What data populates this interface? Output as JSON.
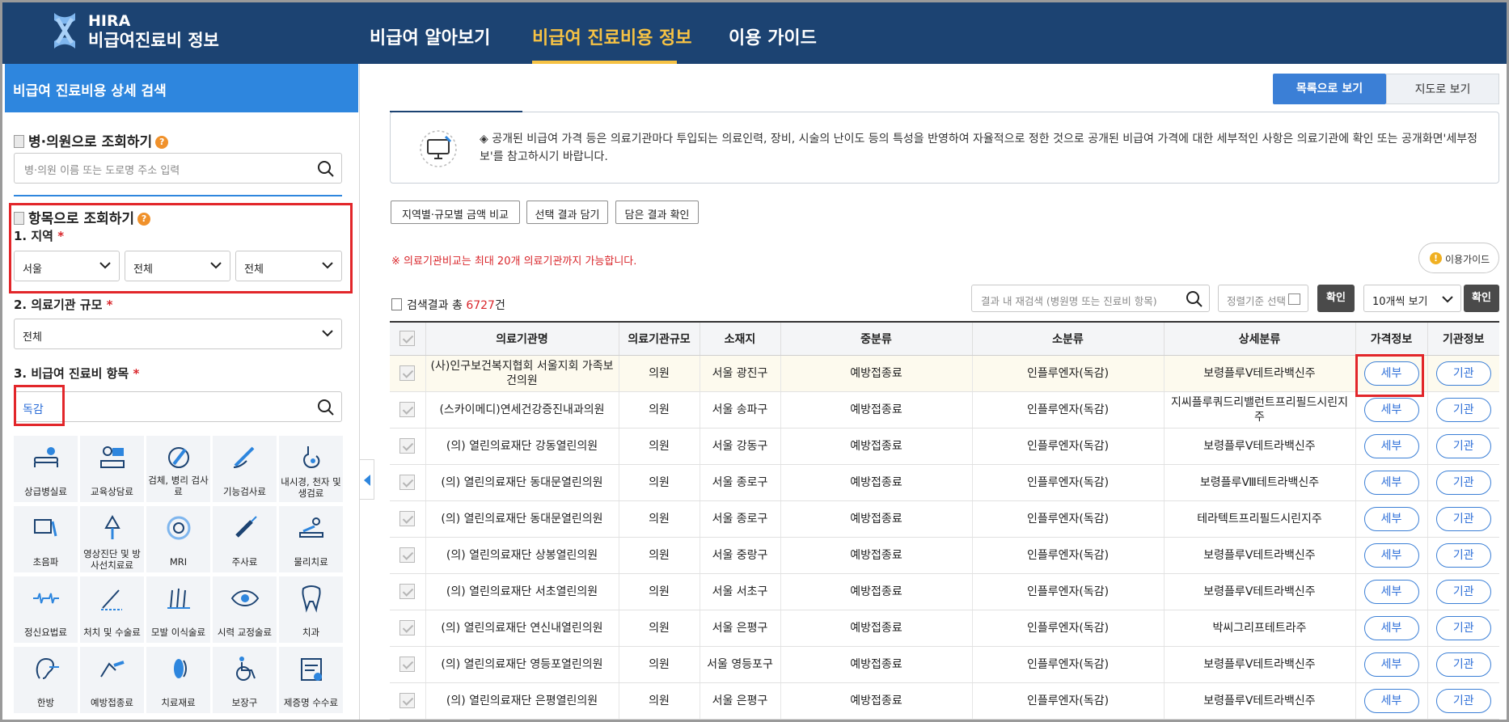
{
  "header": {
    "brand_line1": "HIRA",
    "brand_line2": "비급여진료비 정보",
    "nav": [
      "비급여 알아보기",
      "비급여 진료비용 정보",
      "이용 가이드"
    ],
    "active_nav": 1
  },
  "sidebar": {
    "title": "비급여 진료비용 상세 검색",
    "hospital_search": {
      "heading": "병·의원으로 조회하기",
      "placeholder": "병·의원 이름 또는 도로명 주소 입력"
    },
    "item_search": {
      "heading": "항목으로 조회하기",
      "region_label": "1. 지역",
      "region_values": [
        "서울",
        "전체",
        "전체"
      ],
      "scale_label": "2. 의료기관 규모",
      "scale_value": "전체",
      "item_label": "3. 비급여 진료비 항목",
      "item_value": "독감",
      "required_mark": "*"
    },
    "categories": [
      [
        "상급병실료",
        "교육상담료",
        "검체, 병리 검사료",
        "기능검사료",
        "내시경, 천자 및 생검료"
      ],
      [
        "초음파",
        "영상진단 및 방사선치료료",
        "MRI",
        "주사료",
        "물리치료"
      ],
      [
        "정신요법료",
        "처치 및 수술료",
        "모발 이식술료",
        "시력 교정술료",
        "치과"
      ],
      [
        "한방",
        "예방접종료",
        "치료재료",
        "보장구",
        "제증명 수수료"
      ]
    ]
  },
  "main": {
    "view_list": "목록으로 보기",
    "view_map": "지도로 보기",
    "notice": "◈ 공개된 비급여 가격 등은 의료기관마다 투입되는 의료인력, 장비, 시술의 난이도 등의 특성을 반영하여 자율적으로 정한 것으로 공개된 비급여 가격에 대한 세부적인 사항은 의료기관에 확인 또는 공개화면'세부정보'를 참고하시기 바랍니다.",
    "action_buttons": [
      "지역별·규모별 금액 비교",
      "선택 결과 담기",
      "담은 결과 확인"
    ],
    "warning": "※ 의료기관비교는 최대 20개 의료기관까지 가능합니다.",
    "guide": "이용가이드",
    "result_prefix": "검색결과 총",
    "result_count": "6727",
    "result_suffix": "건",
    "inner_search_placeholder": "결과 내 재검색 (병원명 또는 진료비 항목)",
    "sort_placeholder": "정렬기준 선택",
    "confirm": "확인",
    "per_page": "10개씩 보기"
  },
  "table": {
    "columns": [
      "의료기관명",
      "의료기관규모",
      "소재지",
      "중분류",
      "소분류",
      "상세분류",
      "가격정보",
      "기관정보"
    ],
    "detail_label": "세부",
    "org_label": "기관",
    "rows": [
      [
        "(사)인구보건복지협회 서울지회 가족보건의원",
        "의원",
        "서울 광진구",
        "예방접종료",
        "인플루엔자(독감)",
        "보령플루Ⅴ테트라백신주"
      ],
      [
        "(스카이메디)연세건강증진내과의원",
        "의원",
        "서울 송파구",
        "예방접종료",
        "인플루엔자(독감)",
        "지씨플루쿼드리밸런트프리필드시린지주"
      ],
      [
        "(의) 열린의료재단 강동열린의원",
        "의원",
        "서울 강동구",
        "예방접종료",
        "인플루엔자(독감)",
        "보령플루Ⅴ테트라백신주"
      ],
      [
        "(의) 열린의료재단 동대문열린의원",
        "의원",
        "서울 종로구",
        "예방접종료",
        "인플루엔자(독감)",
        "보령플루Ⅷ테트라백신주"
      ],
      [
        "(의) 열린의료재단 동대문열린의원",
        "의원",
        "서울 종로구",
        "예방접종료",
        "인플루엔자(독감)",
        "테라텍트프리필드시린지주"
      ],
      [
        "(의) 열린의료재단 상봉열린의원",
        "의원",
        "서울 중랑구",
        "예방접종료",
        "인플루엔자(독감)",
        "보령플루Ⅴ테트라백신주"
      ],
      [
        "(의) 열린의료재단 서초열린의원",
        "의원",
        "서울 서초구",
        "예방접종료",
        "인플루엔자(독감)",
        "보령플루Ⅴ테트라백신주"
      ],
      [
        "(의) 열린의료재단 연신내열린의원",
        "의원",
        "서울 은평구",
        "예방접종료",
        "인플루엔자(독감)",
        "박씨그리프테트라주"
      ],
      [
        "(의) 열린의료재단 영등포열린의원",
        "의원",
        "서울 영등포구",
        "예방접종료",
        "인플루엔자(독감)",
        "보령플루Ⅴ테트라백신주"
      ],
      [
        "(의) 열린의료재단 은평열린의원",
        "의원",
        "서울 은평구",
        "예방접종료",
        "인플루엔자(독감)",
        "보령플루Ⅴ테트라백신주"
      ]
    ]
  },
  "colors": {
    "header_bg": "#1c4372",
    "accent_blue": "#2e86de",
    "active_nav": "#f6c244",
    "highlight_red": "#e2262a"
  }
}
